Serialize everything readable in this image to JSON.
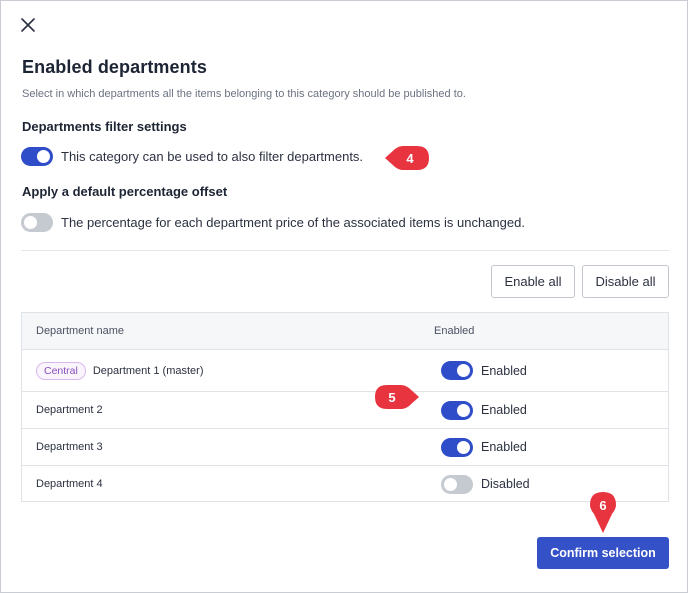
{
  "dialog": {
    "title": "Enabled departments",
    "subtitle": "Select in which departments all the items belonging to this category should be published to."
  },
  "filter_settings": {
    "heading": "Departments filter settings",
    "toggle_on": true,
    "toggle_label": "This category can be used to also filter departments."
  },
  "percentage_offset": {
    "heading": "Apply a default percentage offset",
    "toggle_on": false,
    "toggle_label": "The percentage for each department price of the associated items is unchanged."
  },
  "actions": {
    "enable_all": "Enable all",
    "disable_all": "Disable all",
    "confirm": "Confirm selection"
  },
  "table": {
    "columns": [
      "Department name",
      "Enabled"
    ],
    "rows": [
      {
        "badge": "Central",
        "name": "Department 1 (master)",
        "enabled": true,
        "status": "Enabled"
      },
      {
        "badge": "",
        "name": "Department 2",
        "enabled": true,
        "status": "Enabled"
      },
      {
        "badge": "",
        "name": "Department 3",
        "enabled": true,
        "status": "Enabled"
      },
      {
        "badge": "",
        "name": "Department 4",
        "enabled": false,
        "status": "Disabled"
      }
    ]
  },
  "markers": {
    "m4": "4",
    "m5": "5",
    "m6": "6"
  },
  "colors": {
    "primary": "#3451c7",
    "toggle_off": "#c5c9d0",
    "marker": "#e8343f",
    "badge_text": "#8a4fb8"
  },
  "icons": {
    "close": "close-icon"
  }
}
